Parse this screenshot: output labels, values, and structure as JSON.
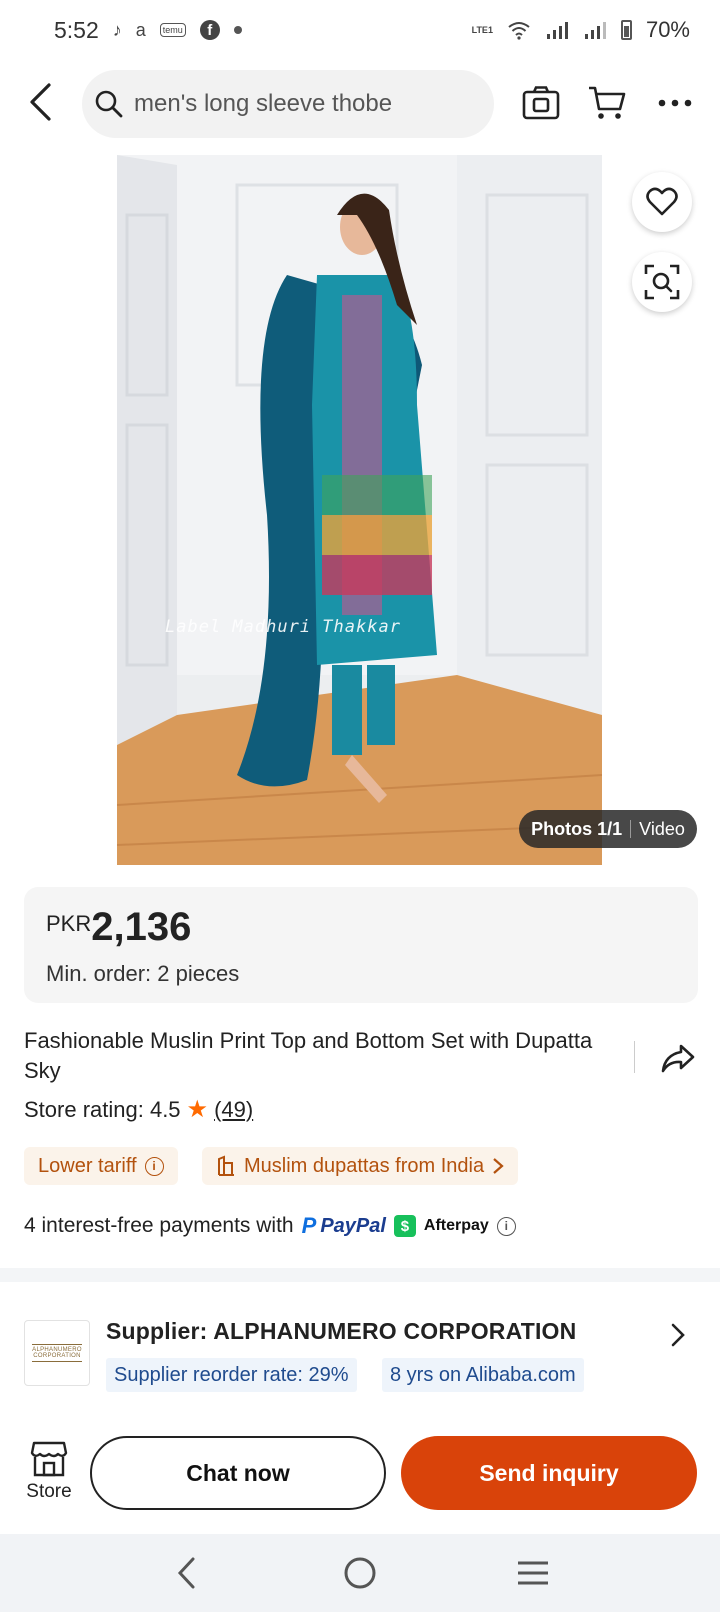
{
  "status_bar": {
    "time": "5:52",
    "temu_label": "temu",
    "network_label": "LTE1",
    "battery": "70%"
  },
  "nav": {
    "search_text": "men's long sleeve thobe"
  },
  "hero": {
    "watermark": "Label Madhuri Thakkar",
    "photos_label": "Photos 1/1",
    "video_label": "Video"
  },
  "price": {
    "currency": "PKR",
    "amount": "2,136",
    "min_order": "Min. order: 2 pieces"
  },
  "product": {
    "title": "Fashionable Muslin Print Top and Bottom Set with Dupatta Sky",
    "rating_label": "Store rating: 4.5",
    "rating_count": "(49)"
  },
  "tags": {
    "tariff": "Lower tariff",
    "category": "Muslim dupattas from India"
  },
  "payments": {
    "text": "4 interest-free payments with",
    "paypal": "PayPal",
    "afterpay": "Afterpay"
  },
  "supplier": {
    "label": "Supplier:",
    "name": "ALPHANUMERO CORPORATION",
    "logo_line1": "ALPHANUMERO",
    "logo_line2": "CORPORATION",
    "reorder_rate": "Supplier reorder rate: 29%",
    "years": "8 yrs on Alibaba.com"
  },
  "bottom_bar": {
    "store_label": "Store",
    "chat_label": "Chat now",
    "inquiry_label": "Send inquiry"
  },
  "colors": {
    "accent": "#d9430a",
    "star": "#ff6a00",
    "tag_text": "#b3520e",
    "badge_text": "#1f4b8e"
  }
}
